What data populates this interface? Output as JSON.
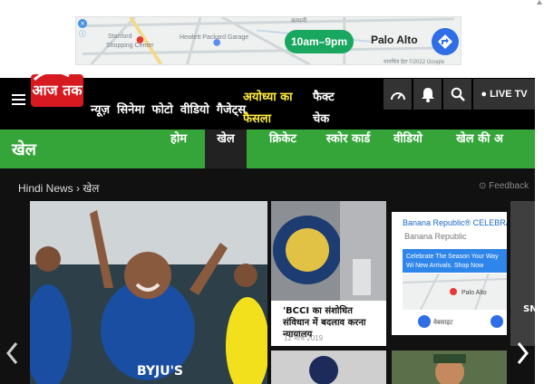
{
  "ad": {
    "hours": "10am–9pm",
    "city": "Palo Alto",
    "map_labels": {
      "stanford": "Stanford",
      "shopping": "Shopping Center",
      "hewlett": "Hewlett Packard Garage",
      "top": "कम्पनी",
      "map_data": "मानचित्र डेटा ©2022 Google"
    },
    "info_icon": "info-icon",
    "close_icon": "close-icon",
    "direction_icon": "directions-icon"
  },
  "header": {
    "logo_text": "आज तक",
    "nav": [
      "न्यूज़",
      "सिनेमा",
      "फोटो",
      "वीडियो",
      "गैजेट्स"
    ],
    "hot_link_line1": "अयोध्या का",
    "hot_link_line2": "फैसला",
    "fact_line1": "फैक्ट",
    "fact_line2": "चेक",
    "live_label": "LIVE TV",
    "icons": [
      "speed-icon",
      "bell-icon",
      "search-icon"
    ]
  },
  "subnav": {
    "title": "खेल",
    "tabs": [
      "होम",
      "खेल",
      "क्रिकेट",
      "स्कोर कार्ड",
      "वीडियो",
      "खेल की अ"
    ],
    "active_index": 1
  },
  "breadcrumb": {
    "home": "Hindi News",
    "current": "खेल"
  },
  "feedback": "Feedback",
  "cards": {
    "card1_title": "'BCCI का संशोधित संविधान में बदलाव करना न्यायालय",
    "card1_date": "12 मार्च 2019",
    "ad_title": "Banana Republic® CELEBRATE",
    "ad_sub": "Banana Republic",
    "ad_banner": "Celebrate The Season Your Way Wi New Arrivals. Shop Now",
    "ad_map_city": "Palo Alto",
    "ad_btn1": "वेबसाइट",
    "side_text": "SN"
  },
  "colors": {
    "green": "#35a53a",
    "red": "#d71920",
    "black": "#000000",
    "yellow": "#ffeb3b"
  }
}
